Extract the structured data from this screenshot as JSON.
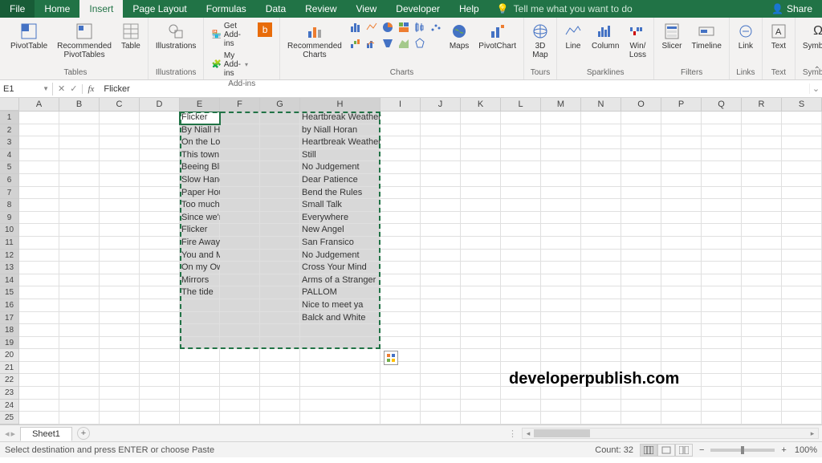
{
  "menubar": {
    "tabs": [
      "File",
      "Home",
      "Insert",
      "Page Layout",
      "Formulas",
      "Data",
      "Review",
      "View",
      "Developer",
      "Help"
    ],
    "active_index": 2,
    "tell_me": "Tell me what you want to do",
    "share": "Share"
  },
  "ribbon": {
    "tables": {
      "label": "Tables",
      "pivot": "PivotTable",
      "rec_pivot": "Recommended\nPivotTables",
      "table": "Table"
    },
    "illustrations": {
      "label": "Illustrations",
      "btn": "Illustrations"
    },
    "addins": {
      "label": "Add-ins",
      "get": "Get Add-ins",
      "my": "My Add-ins"
    },
    "charts": {
      "label": "Charts",
      "rec": "Recommended\nCharts",
      "maps": "Maps",
      "pivotchart": "PivotChart"
    },
    "tours": {
      "label": "Tours",
      "map3d": "3D\nMap"
    },
    "sparklines": {
      "label": "Sparklines",
      "line": "Line",
      "column": "Column",
      "winloss": "Win/\nLoss"
    },
    "filters": {
      "label": "Filters",
      "slicer": "Slicer",
      "timeline": "Timeline"
    },
    "links": {
      "label": "Links",
      "link": "Link"
    },
    "text": {
      "label": "Text",
      "btn": "Text"
    },
    "symbols": {
      "label": "Symbols",
      "btn": "Symbols"
    }
  },
  "formula": {
    "name_box": "E1",
    "content": "Flicker"
  },
  "cols": [
    "A",
    "B",
    "C",
    "D",
    "E",
    "F",
    "G",
    "H",
    "I",
    "J",
    "K",
    "L",
    "M",
    "N",
    "O",
    "P",
    "Q",
    "R",
    "S"
  ],
  "row_count": 25,
  "selected_cols": [
    "E",
    "F",
    "G",
    "H"
  ],
  "selected_rows_from": 1,
  "selected_rows_to": 19,
  "cells": {
    "E1": "Flicker",
    "H1": "Heartbreak Weather",
    "E2": "By Niall Horan",
    "H2": "by  Niall Horan",
    "E3": "On the Loose",
    "H3": "Heartbreak Weather",
    "E4": "This town",
    "H4": "Still",
    "E5": "Beeing Blind",
    "H5": "No Judgement",
    "E6": "Slow Hands",
    "H6": "Dear Patience",
    "E7": "Paper Houses",
    "H7": "Bend the Rules",
    "E8": "Too much to ask",
    "H8": "Small Talk",
    "E9": "Since we're alone",
    "H9": "Everywhere",
    "E10": "Flicker",
    "H10": "New Angel",
    "E11": "Fire Away",
    "H11": "San Fransico",
    "E12": "You and Me",
    "H12": "No Judgement",
    "E13": "On my Own",
    "H13": "Cross Your Mind",
    "E14": "Mirrors",
    "H14": "Arms of a Stranger",
    "E15": "The tide",
    "H15": "PALLOM",
    "H16": "Nice to meet ya",
    "H17": "Balck and White"
  },
  "watermark": "developerpublish.com",
  "sheet": {
    "name": "Sheet1"
  },
  "status": {
    "msg": "Select destination and press ENTER or choose Paste",
    "count_lbl": "Count:",
    "count": "32",
    "zoom_minus": "−",
    "zoom_plus": "+",
    "zoom": "100%"
  }
}
